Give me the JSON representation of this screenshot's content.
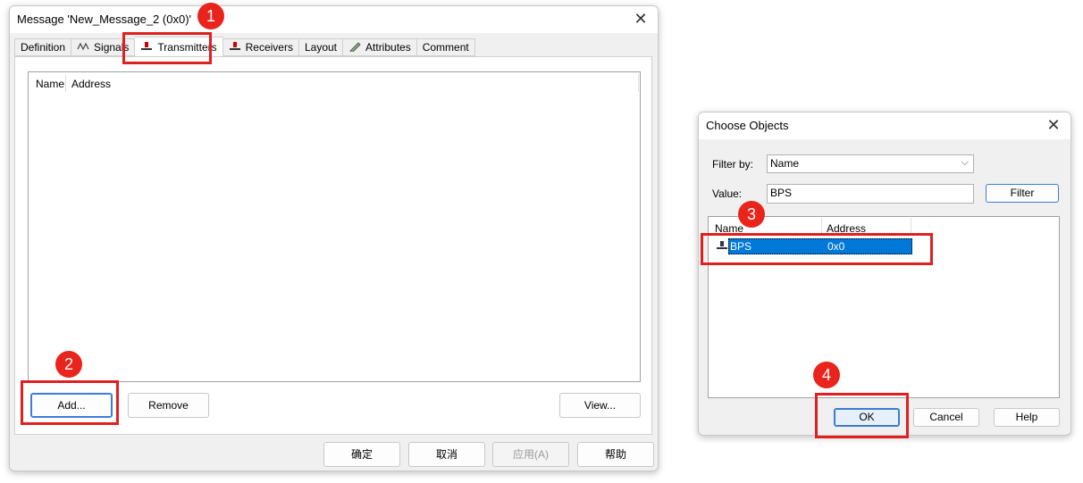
{
  "main_dialog": {
    "title": "Message 'New_Message_2 (0x0)'",
    "close": "✕",
    "tabs": [
      {
        "label": "Definition"
      },
      {
        "label": "Signals"
      },
      {
        "label": "Transmitters"
      },
      {
        "label": "Receivers"
      },
      {
        "label": "Layout"
      },
      {
        "label": "Attributes"
      },
      {
        "label": "Comment"
      }
    ],
    "list_headers": [
      "Name",
      "Address"
    ],
    "buttons": {
      "add": "Add...",
      "remove": "Remove",
      "view": "View..."
    },
    "footer": {
      "ok": "确定",
      "cancel": "取消",
      "apply": "应用(A)",
      "help": "帮助"
    }
  },
  "choose_dialog": {
    "title": "Choose Objects",
    "close": "✕",
    "filter_by_label": "Filter by:",
    "filter_by_value": "Name",
    "value_label": "Value:",
    "value_input": "BPS",
    "filter_button": "Filter",
    "list_headers": [
      "Name",
      "Address"
    ],
    "rows": [
      {
        "name": "BPS",
        "address": "0x0"
      }
    ],
    "buttons": {
      "ok": "OK",
      "cancel": "Cancel",
      "help": "Help"
    }
  },
  "annotations": {
    "b1": "1",
    "b2": "2",
    "b3": "3",
    "b4": "4"
  },
  "colors": {
    "badge": "#e8241c",
    "highlight_box": "#e02020",
    "selection": "#0078d7"
  }
}
